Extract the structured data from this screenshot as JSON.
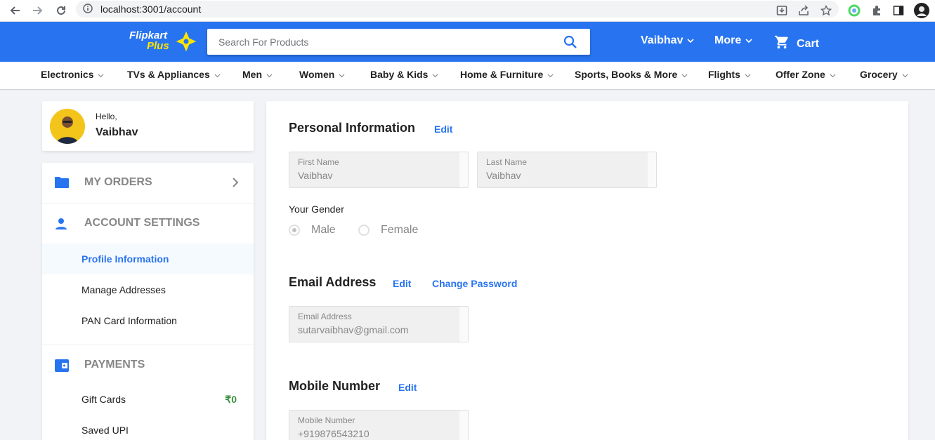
{
  "browser": {
    "url": "localhost:3001/account"
  },
  "header": {
    "logo_text": "Flipkart",
    "logo_plus": "Plus",
    "search_placeholder": "Search For Products",
    "user_label": "Vaibhav",
    "more_label": "More",
    "cart_label": "Cart",
    "color": "#2874f0"
  },
  "categories": [
    "Electronics",
    "TVs & Appliances",
    "Men",
    "Women",
    "Baby & Kids",
    "Home & Furniture",
    "Sports, Books & More",
    "Flights",
    "Offer Zone",
    "Grocery"
  ],
  "sidebar": {
    "hello": "Hello,",
    "name": "Vaibhav",
    "my_orders": "MY ORDERS",
    "account_settings": "ACCOUNT SETTINGS",
    "account_items": [
      "Profile Information",
      "Manage Addresses",
      "PAN Card Information"
    ],
    "payments": "PAYMENTS",
    "payment_items": [
      "Gift Cards",
      "Saved UPI"
    ],
    "gift_card_amount": "₹0"
  },
  "profile": {
    "personal_title": "Personal Information",
    "edit_label": "Edit",
    "first_name_label": "First Name",
    "first_name_value": "Vaibhav",
    "last_name_label": "Last Name",
    "last_name_value": "Vaibhav",
    "gender_label": "Your Gender",
    "gender_options": [
      "Male",
      "Female"
    ],
    "gender_selected": "Male",
    "email_title": "Email Address",
    "change_password": "Change Password",
    "email_label": "Email Address",
    "email_value": "sutarvaibhav@gmail.com",
    "mobile_title": "Mobile Number",
    "mobile_label": "Mobile Number",
    "mobile_value": "+919876543210"
  },
  "icons": [
    "back-icon",
    "forward-icon",
    "reload-icon",
    "info-icon",
    "install-icon",
    "share-icon",
    "star-icon",
    "extension-icon",
    "puzzle-icon",
    "sidepanel-icon",
    "profile-icon",
    "search-icon",
    "chevron-down-icon",
    "cart-icon",
    "folder-icon",
    "person-icon",
    "wallet-icon",
    "chevron-right-icon"
  ]
}
